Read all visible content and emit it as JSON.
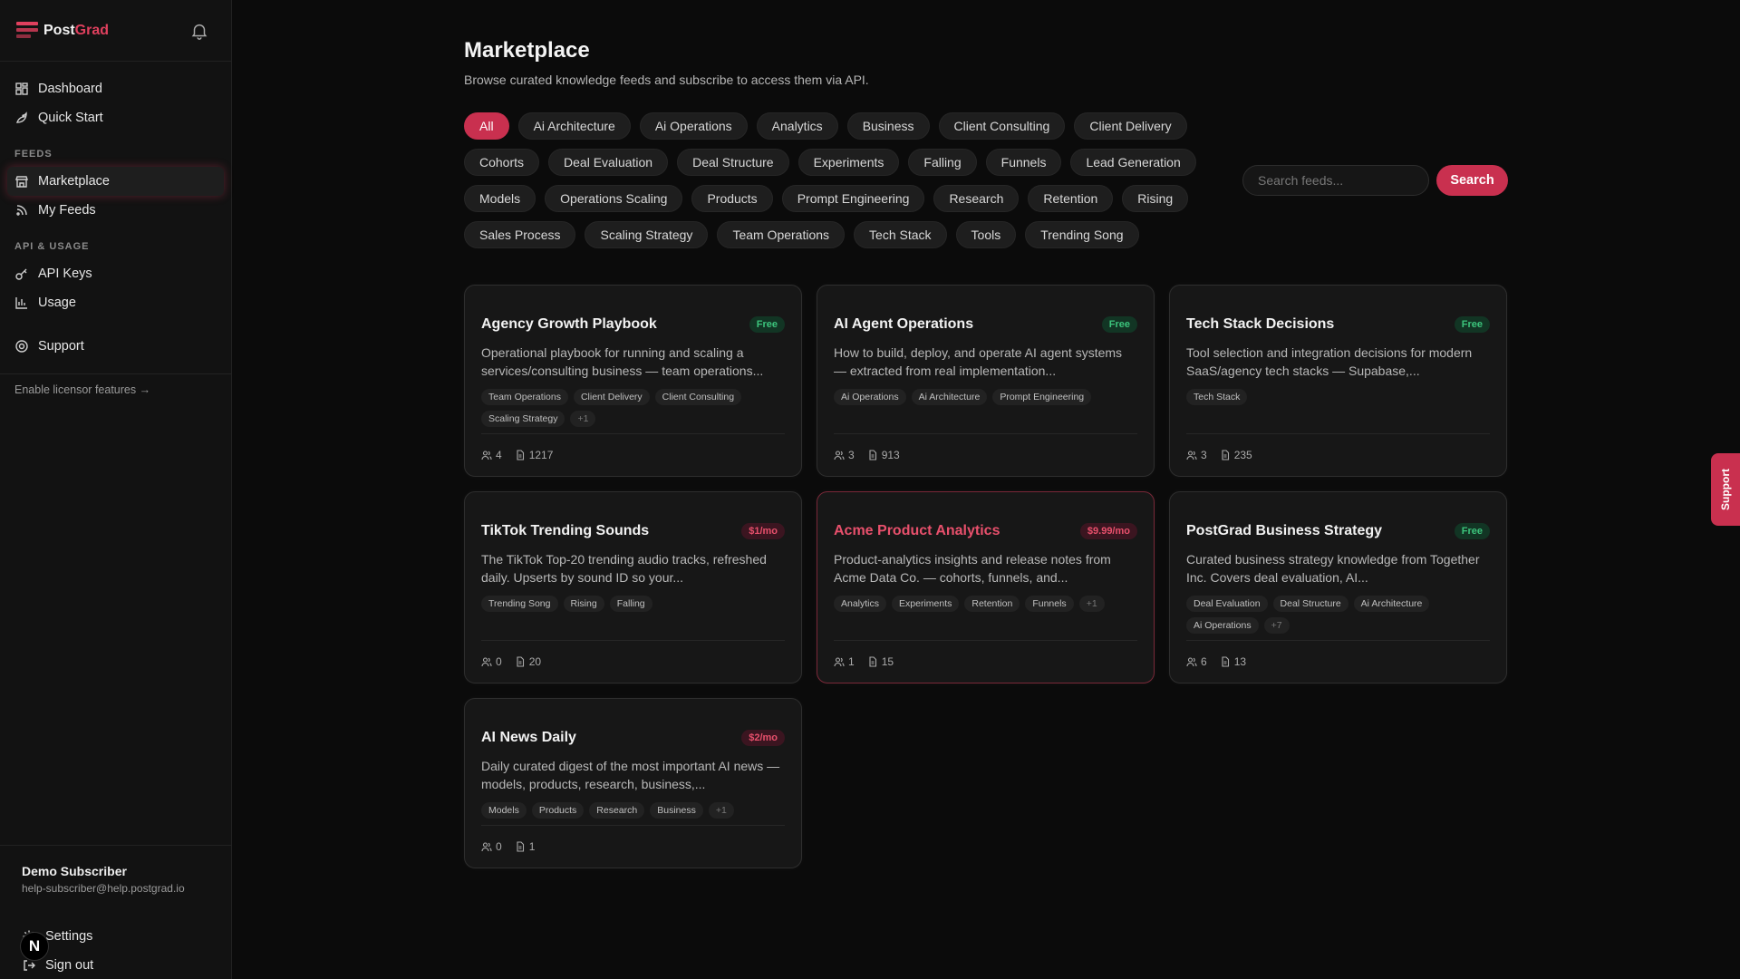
{
  "app": {
    "logo_a": "Post",
    "logo_b": "Grad"
  },
  "nav": {
    "dashboard": "Dashboard",
    "quick_start": "Quick Start",
    "feeds_label": "FEEDS",
    "marketplace": "Marketplace",
    "my_feeds": "My Feeds",
    "api_label": "API & USAGE",
    "api_keys": "API Keys",
    "usage": "Usage",
    "support": "Support",
    "licensor": "Enable licensor features →"
  },
  "user": {
    "name": "Demo Subscriber",
    "email": "help-subscriber@help.postgrad.io",
    "settings": "Settings",
    "sign_out": "Sign out",
    "avatar": "N"
  },
  "page": {
    "title": "Marketplace",
    "subtitle": "Browse curated knowledge feeds and subscribe to access them via API."
  },
  "filters": [
    "All",
    "Ai Architecture",
    "Ai Operations",
    "Analytics",
    "Business",
    "Client Consulting",
    "Client Delivery",
    "Cohorts",
    "Deal Evaluation",
    "Deal Structure",
    "Experiments",
    "Falling",
    "Funnels",
    "Lead Generation",
    "Models",
    "Operations Scaling",
    "Products",
    "Prompt Engineering",
    "Research",
    "Retention",
    "Rising",
    "Sales Process",
    "Scaling Strategy",
    "Team Operations",
    "Tech Stack",
    "Tools",
    "Trending Song"
  ],
  "search": {
    "placeholder": "Search feeds...",
    "button": "Search"
  },
  "cards": [
    {
      "title": "Agency Growth Playbook",
      "badge": "Free",
      "desc": "Operational playbook for running and scaling a services/consulting business — team operations...",
      "tags": [
        "Team Operations",
        "Client Delivery",
        "Client Consulting",
        "Scaling Strategy"
      ],
      "more": "+1",
      "subs": "4",
      "docs": "1217"
    },
    {
      "title": "AI Agent Operations",
      "badge": "Free",
      "desc": "How to build, deploy, and operate AI agent systems — extracted from real implementation...",
      "tags": [
        "Ai Operations",
        "Ai Architecture",
        "Prompt Engineering"
      ],
      "more": "",
      "subs": "3",
      "docs": "913"
    },
    {
      "title": "Tech Stack Decisions",
      "badge": "Free",
      "desc": "Tool selection and integration decisions for modern SaaS/agency tech stacks — Supabase,...",
      "tags": [
        "Tech Stack"
      ],
      "more": "",
      "subs": "3",
      "docs": "235"
    },
    {
      "title": "TikTok Trending Sounds",
      "badge": "$1/mo",
      "desc": "The TikTok Top-20 trending audio tracks, refreshed daily. Upserts by sound ID so your...",
      "tags": [
        "Trending Song",
        "Rising",
        "Falling"
      ],
      "more": "",
      "subs": "0",
      "docs": "20"
    },
    {
      "title": "Acme Product Analytics",
      "badge": "$9.99/mo",
      "desc": "Product-analytics insights and release notes from Acme Data Co. — cohorts, funnels, and...",
      "tags": [
        "Analytics",
        "Experiments",
        "Retention",
        "Funnels"
      ],
      "more": "+1",
      "subs": "1",
      "docs": "15"
    },
    {
      "title": "PostGrad Business Strategy",
      "badge": "Free",
      "desc": "Curated business strategy knowledge from Together Inc. Covers deal evaluation, AI...",
      "tags": [
        "Deal Evaluation",
        "Deal Structure",
        "Ai Architecture",
        "Ai Operations"
      ],
      "more": "+7",
      "subs": "6",
      "docs": "13"
    },
    {
      "title": "AI News Daily",
      "badge": "$2/mo",
      "desc": "Daily curated digest of the most important AI news — models, products, research, business,...",
      "tags": [
        "Models",
        "Products",
        "Research",
        "Business"
      ],
      "more": "+1",
      "subs": "0",
      "docs": "1"
    }
  ],
  "support_tab": "Support",
  "colors": {
    "accent": "#c9304f",
    "free": "#3cc47c",
    "bg": "#0b0b0b"
  }
}
